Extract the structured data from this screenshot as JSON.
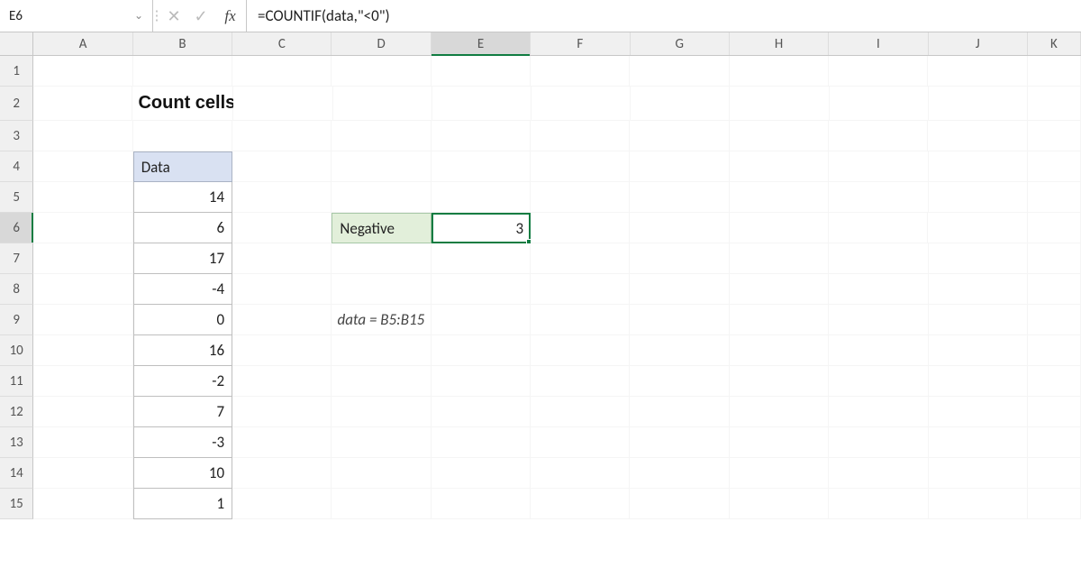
{
  "nameBox": "E6",
  "formula": "=COUNTIF(data,\"<0\")",
  "columns": [
    "A",
    "B",
    "C",
    "D",
    "E",
    "F",
    "G",
    "H",
    "I",
    "J",
    "K"
  ],
  "activeColumn": "E",
  "activeRow": 6,
  "rowNumbers": [
    1,
    2,
    3,
    4,
    5,
    6,
    7,
    8,
    9,
    10,
    11,
    12,
    13,
    14,
    15
  ],
  "title": "Count cells that contain negative numbers",
  "dataHeader": "Data",
  "data": [
    14,
    6,
    17,
    -4,
    0,
    16,
    -2,
    7,
    -3,
    10,
    1
  ],
  "negative": {
    "label": "Negative",
    "value": 3
  },
  "note": "data = B5:B15",
  "fxLabel": "fx",
  "icons": {
    "chevronDown": "⌄",
    "cancel": "✕",
    "accept": "✓",
    "sep": "⋮"
  }
}
